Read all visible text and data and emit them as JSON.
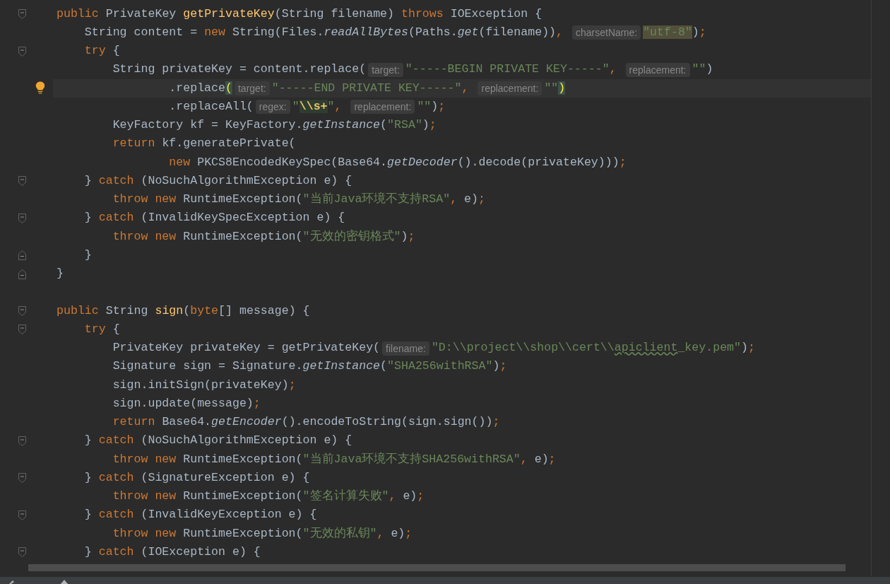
{
  "editor": {
    "lines": [
      {
        "kind": "fold_start",
        "current": false,
        "bulb": false,
        "tokens": [
          {
            "kind": "kw",
            "text": "public "
          },
          {
            "kind": "pl",
            "text": "PrivateKey "
          },
          {
            "kind": "fn",
            "text": "getPrivateKey"
          },
          {
            "kind": "pl",
            "text": "(String filename) "
          },
          {
            "kind": "kw",
            "text": "throws "
          },
          {
            "kind": "pl",
            "text": "IOException {"
          }
        ]
      },
      {
        "kind": "plain",
        "current": false,
        "bulb": false,
        "tokens": [
          {
            "kind": "pl",
            "text": "    String content = "
          },
          {
            "kind": "kw",
            "text": "new "
          },
          {
            "kind": "pl",
            "text": "String(Files."
          },
          {
            "kind": "it",
            "text": "readAllBytes"
          },
          {
            "kind": "pl",
            "text": "(Paths."
          },
          {
            "kind": "it",
            "text": "get"
          },
          {
            "kind": "pl",
            "text": "(filename))"
          },
          {
            "kind": "pu",
            "text": ", "
          },
          {
            "kind": "hint",
            "text": "charsetName:"
          },
          {
            "kind": "hl",
            "text": "\"utf-8\""
          },
          {
            "kind": "pl",
            "text": ")"
          },
          {
            "kind": "pu",
            "text": ";"
          }
        ]
      },
      {
        "kind": "fold_start",
        "current": false,
        "bulb": false,
        "tokens": [
          {
            "kind": "kw",
            "text": "    try "
          },
          {
            "kind": "pl",
            "text": "{"
          }
        ]
      },
      {
        "kind": "plain",
        "current": false,
        "bulb": false,
        "tokens": [
          {
            "kind": "pl",
            "text": "        String privateKey = content.replace("
          },
          {
            "kind": "hint",
            "text": "target:"
          },
          {
            "kind": "st",
            "text": "\"-----BEGIN PRIVATE KEY-----\""
          },
          {
            "kind": "pu",
            "text": ", "
          },
          {
            "kind": "hint",
            "text": "replacement:"
          },
          {
            "kind": "st",
            "text": "\"\""
          },
          {
            "kind": "pl",
            "text": ")"
          }
        ]
      },
      {
        "kind": "plain",
        "current": true,
        "bulb": true,
        "tokens": [
          {
            "kind": "pl",
            "text": "                .replace"
          },
          {
            "kind": "pm",
            "text": "("
          },
          {
            "kind": "hint",
            "text": "target:"
          },
          {
            "kind": "st",
            "text": "\"-----END PRIVATE KEY-----\""
          },
          {
            "kind": "pu",
            "text": ", "
          },
          {
            "kind": "hint",
            "text": "replacement:"
          },
          {
            "kind": "st",
            "text": "\"\""
          },
          {
            "kind": "pm",
            "text": ")"
          }
        ]
      },
      {
        "kind": "plain",
        "current": false,
        "bulb": false,
        "tokens": [
          {
            "kind": "pl",
            "text": "                .replaceAll("
          },
          {
            "kind": "hint",
            "text": "regex:"
          },
          {
            "kind": "st",
            "text": "\""
          },
          {
            "kind": "rx",
            "text": "\\\\s+"
          },
          {
            "kind": "st",
            "text": "\""
          },
          {
            "kind": "pu",
            "text": ", "
          },
          {
            "kind": "hint",
            "text": "replacement:"
          },
          {
            "kind": "st",
            "text": "\"\""
          },
          {
            "kind": "pl",
            "text": ")"
          },
          {
            "kind": "pu",
            "text": ";"
          }
        ]
      },
      {
        "kind": "plain",
        "current": false,
        "bulb": false,
        "tokens": [
          {
            "kind": "pl",
            "text": "        KeyFactory kf = KeyFactory."
          },
          {
            "kind": "it",
            "text": "getInstance"
          },
          {
            "kind": "pl",
            "text": "("
          },
          {
            "kind": "st",
            "text": "\"RSA\""
          },
          {
            "kind": "pl",
            "text": ")"
          },
          {
            "kind": "pu",
            "text": ";"
          }
        ]
      },
      {
        "kind": "plain",
        "current": false,
        "bulb": false,
        "tokens": [
          {
            "kind": "kw",
            "text": "        return "
          },
          {
            "kind": "pl",
            "text": "kf.generatePrivate("
          }
        ]
      },
      {
        "kind": "plain",
        "current": false,
        "bulb": false,
        "tokens": [
          {
            "kind": "kw",
            "text": "                new "
          },
          {
            "kind": "pl",
            "text": "PKCS8EncodedKeySpec(Base64."
          },
          {
            "kind": "it",
            "text": "getDecoder"
          },
          {
            "kind": "pl",
            "text": "().decode(privateKey)))"
          },
          {
            "kind": "pu",
            "text": ";"
          }
        ]
      },
      {
        "kind": "fold_start",
        "current": false,
        "bulb": false,
        "tokens": [
          {
            "kind": "pl",
            "text": "    } "
          },
          {
            "kind": "kw",
            "text": "catch "
          },
          {
            "kind": "pl",
            "text": "(NoSuchAlgorithmException e) {"
          }
        ]
      },
      {
        "kind": "plain",
        "current": false,
        "bulb": false,
        "tokens": [
          {
            "kind": "kw",
            "text": "        throw new "
          },
          {
            "kind": "pl",
            "text": "RuntimeException("
          },
          {
            "kind": "st",
            "text": "\"当前Java环境不支持RSA\""
          },
          {
            "kind": "pu",
            "text": ", "
          },
          {
            "kind": "pl",
            "text": "e)"
          },
          {
            "kind": "pu",
            "text": ";"
          }
        ]
      },
      {
        "kind": "fold_start",
        "current": false,
        "bulb": false,
        "tokens": [
          {
            "kind": "pl",
            "text": "    } "
          },
          {
            "kind": "kw",
            "text": "catch "
          },
          {
            "kind": "pl",
            "text": "(InvalidKeySpecException e) {"
          }
        ]
      },
      {
        "kind": "plain",
        "current": false,
        "bulb": false,
        "tokens": [
          {
            "kind": "kw",
            "text": "        throw new "
          },
          {
            "kind": "pl",
            "text": "RuntimeException("
          },
          {
            "kind": "st",
            "text": "\"无效的密钥格式\""
          },
          {
            "kind": "pl",
            "text": ")"
          },
          {
            "kind": "pu",
            "text": ";"
          }
        ]
      },
      {
        "kind": "fold_end",
        "current": false,
        "bulb": false,
        "tokens": [
          {
            "kind": "pl",
            "text": "    }"
          }
        ]
      },
      {
        "kind": "fold_end",
        "current": false,
        "bulb": false,
        "tokens": [
          {
            "kind": "pl",
            "text": "}"
          }
        ]
      },
      {
        "kind": "plain",
        "current": false,
        "bulb": false
      },
      {
        "kind": "fold_start",
        "current": false,
        "bulb": false,
        "tokens": [
          {
            "kind": "kw",
            "text": "public "
          },
          {
            "kind": "pl",
            "text": "String "
          },
          {
            "kind": "fn",
            "text": "sign"
          },
          {
            "kind": "pl",
            "text": "("
          },
          {
            "kind": "kw",
            "text": "byte"
          },
          {
            "kind": "pl",
            "text": "[] message) {"
          }
        ]
      },
      {
        "kind": "fold_start",
        "current": false,
        "bulb": false,
        "tokens": [
          {
            "kind": "kw",
            "text": "    try "
          },
          {
            "kind": "pl",
            "text": "{"
          }
        ]
      },
      {
        "kind": "plain",
        "current": false,
        "bulb": false,
        "tokens": [
          {
            "kind": "pl",
            "text": "        PrivateKey privateKey = getPrivateKey("
          },
          {
            "kind": "hint",
            "text": "filename:"
          },
          {
            "kind": "st",
            "text": "\"D:\\\\project\\\\shop\\\\cert\\\\"
          },
          {
            "kind": "ty",
            "text": "apiclient"
          },
          {
            "kind": "st",
            "text": "_key.pem\""
          },
          {
            "kind": "pl",
            "text": ")"
          },
          {
            "kind": "pu",
            "text": ";"
          }
        ]
      },
      {
        "kind": "plain",
        "current": false,
        "bulb": false,
        "tokens": [
          {
            "kind": "pl",
            "text": "        Signature sign = Signature."
          },
          {
            "kind": "it",
            "text": "getInstance"
          },
          {
            "kind": "pl",
            "text": "("
          },
          {
            "kind": "st",
            "text": "\"SHA256withRSA\""
          },
          {
            "kind": "pl",
            "text": ")"
          },
          {
            "kind": "pu",
            "text": ";"
          }
        ]
      },
      {
        "kind": "plain",
        "current": false,
        "bulb": false,
        "tokens": [
          {
            "kind": "pl",
            "text": "        sign.initSign(privateKey)"
          },
          {
            "kind": "pu",
            "text": ";"
          }
        ]
      },
      {
        "kind": "plain",
        "current": false,
        "bulb": false,
        "tokens": [
          {
            "kind": "pl",
            "text": "        sign.update(message)"
          },
          {
            "kind": "pu",
            "text": ";"
          }
        ]
      },
      {
        "kind": "plain",
        "current": false,
        "bulb": false,
        "tokens": [
          {
            "kind": "kw",
            "text": "        return "
          },
          {
            "kind": "pl",
            "text": "Base64."
          },
          {
            "kind": "it",
            "text": "getEncoder"
          },
          {
            "kind": "pl",
            "text": "().encodeToString(sign.sign())"
          },
          {
            "kind": "pu",
            "text": ";"
          }
        ]
      },
      {
        "kind": "fold_start",
        "current": false,
        "bulb": false,
        "tokens": [
          {
            "kind": "pl",
            "text": "    } "
          },
          {
            "kind": "kw",
            "text": "catch "
          },
          {
            "kind": "pl",
            "text": "(NoSuchAlgorithmException e) {"
          }
        ]
      },
      {
        "kind": "plain",
        "current": false,
        "bulb": false,
        "tokens": [
          {
            "kind": "kw",
            "text": "        throw new "
          },
          {
            "kind": "pl",
            "text": "RuntimeException("
          },
          {
            "kind": "st",
            "text": "\"当前Java环境不支持SHA256withRSA\""
          },
          {
            "kind": "pu",
            "text": ", "
          },
          {
            "kind": "pl",
            "text": "e)"
          },
          {
            "kind": "pu",
            "text": ";"
          }
        ]
      },
      {
        "kind": "fold_start",
        "current": false,
        "bulb": false,
        "tokens": [
          {
            "kind": "pl",
            "text": "    } "
          },
          {
            "kind": "kw",
            "text": "catch "
          },
          {
            "kind": "pl",
            "text": "(SignatureException e) {"
          }
        ]
      },
      {
        "kind": "plain",
        "current": false,
        "bulb": false,
        "tokens": [
          {
            "kind": "kw",
            "text": "        throw new "
          },
          {
            "kind": "pl",
            "text": "RuntimeException("
          },
          {
            "kind": "st",
            "text": "\"签名计算失败\""
          },
          {
            "kind": "pu",
            "text": ", "
          },
          {
            "kind": "pl",
            "text": "e)"
          },
          {
            "kind": "pu",
            "text": ";"
          }
        ]
      },
      {
        "kind": "fold_start",
        "current": false,
        "bulb": false,
        "tokens": [
          {
            "kind": "pl",
            "text": "    } "
          },
          {
            "kind": "kw",
            "text": "catch "
          },
          {
            "kind": "pl",
            "text": "(InvalidKeyException e) {"
          }
        ]
      },
      {
        "kind": "plain",
        "current": false,
        "bulb": false,
        "tokens": [
          {
            "kind": "kw",
            "text": "        throw new "
          },
          {
            "kind": "pl",
            "text": "RuntimeException("
          },
          {
            "kind": "st",
            "text": "\"无效的私钥\""
          },
          {
            "kind": "pu",
            "text": ", "
          },
          {
            "kind": "pl",
            "text": "e)"
          },
          {
            "kind": "pu",
            "text": ";"
          }
        ]
      },
      {
        "kind": "fold_start",
        "current": false,
        "bulb": false,
        "tokens": [
          {
            "kind": "pl",
            "text": "    } "
          },
          {
            "kind": "kw",
            "text": "catch "
          },
          {
            "kind": "pl",
            "text": "(IOException e) {"
          }
        ]
      }
    ]
  }
}
